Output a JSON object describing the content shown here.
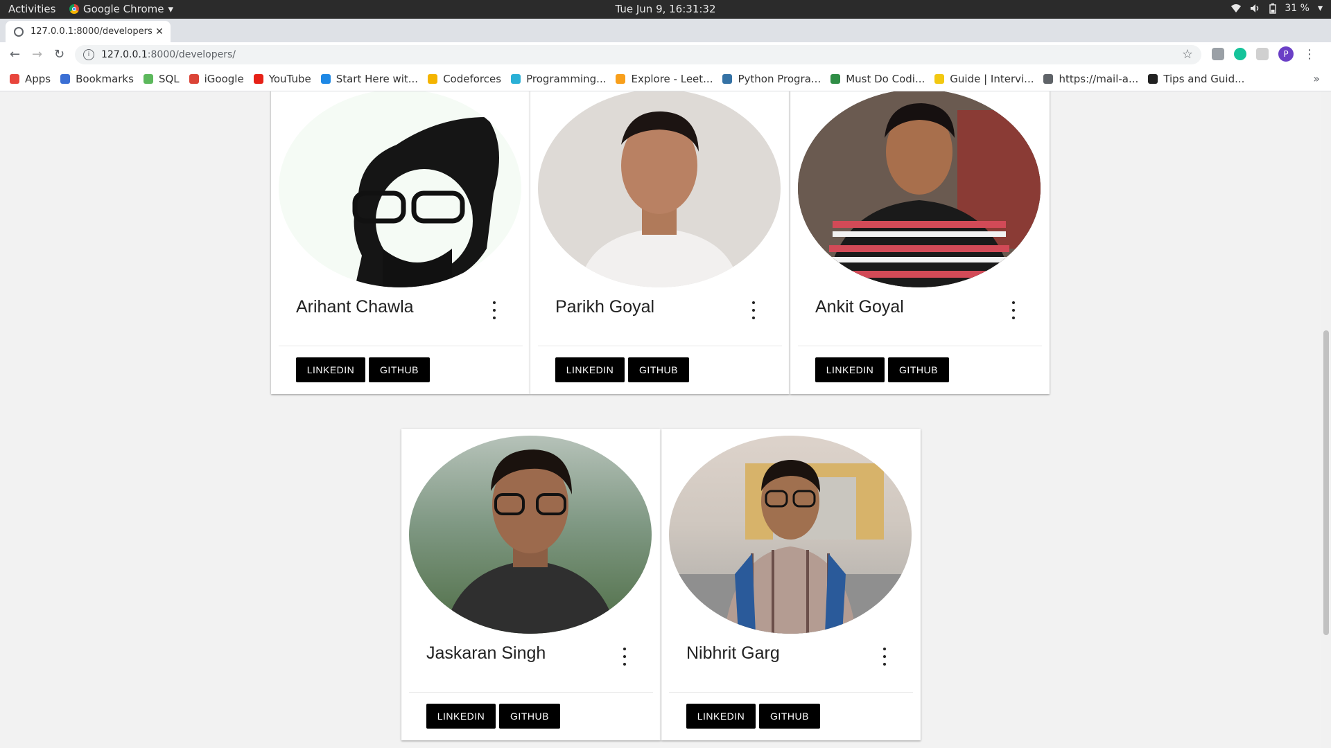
{
  "system_bar": {
    "activities": "Activities",
    "app_name": "Google Chrome",
    "clock": "Tue Jun  9, 16:31:32",
    "battery": "31 %"
  },
  "browser": {
    "tab_title": "127.0.0.1:8000/developers/",
    "url_host": "127.0.0.1",
    "url_rest": ":8000/developers/",
    "profile_initial": "P",
    "bookmarks": [
      {
        "label": "Apps",
        "icon": "apps-grid-icon",
        "color": "#e8453c"
      },
      {
        "label": "Bookmarks",
        "icon": "star-icon",
        "color": "#3b6fd4"
      },
      {
        "label": "SQL",
        "icon": "sql-icon",
        "color": "#5cb85c"
      },
      {
        "label": "iGoogle",
        "icon": "google-icon",
        "color": "#db4437"
      },
      {
        "label": "YouTube",
        "icon": "youtube-icon",
        "color": "#e62117"
      },
      {
        "label": "Start Here wit...",
        "icon": "p-icon",
        "color": "#1e88e5"
      },
      {
        "label": "Codeforces",
        "icon": "codeforces-icon",
        "color": "#f4b400"
      },
      {
        "label": "Programming...",
        "icon": "ib-icon",
        "color": "#2ab0d6"
      },
      {
        "label": "Explore - Leet...",
        "icon": "leetcode-icon",
        "color": "#f89f1b"
      },
      {
        "label": "Python Progra...",
        "icon": "python-icon",
        "color": "#3572a5"
      },
      {
        "label": "Must Do Codi...",
        "icon": "gfg-icon",
        "color": "#2f8d46"
      },
      {
        "label": "Guide | Intervi...",
        "icon": "folder-icon",
        "color": "#f2c811"
      },
      {
        "label": "https://mail-a...",
        "icon": "globe-icon",
        "color": "#5f6368"
      },
      {
        "label": "Tips and Guid...",
        "icon": "hackerearth-icon",
        "color": "#222222"
      }
    ]
  },
  "developers": [
    {
      "name": "Arihant Chawla",
      "linkedin": "LINKEDIN",
      "github": "GITHUB"
    },
    {
      "name": "Parikh Goyal",
      "linkedin": "LINKEDIN",
      "github": "GITHUB"
    },
    {
      "name": "Ankit Goyal",
      "linkedin": "LINKEDIN",
      "github": "GITHUB"
    },
    {
      "name": "Jaskaran Singh",
      "linkedin": "LINKEDIN",
      "github": "GITHUB"
    },
    {
      "name": "Nibhrit Garg",
      "linkedin": "LINKEDIN",
      "github": "GITHUB"
    }
  ]
}
